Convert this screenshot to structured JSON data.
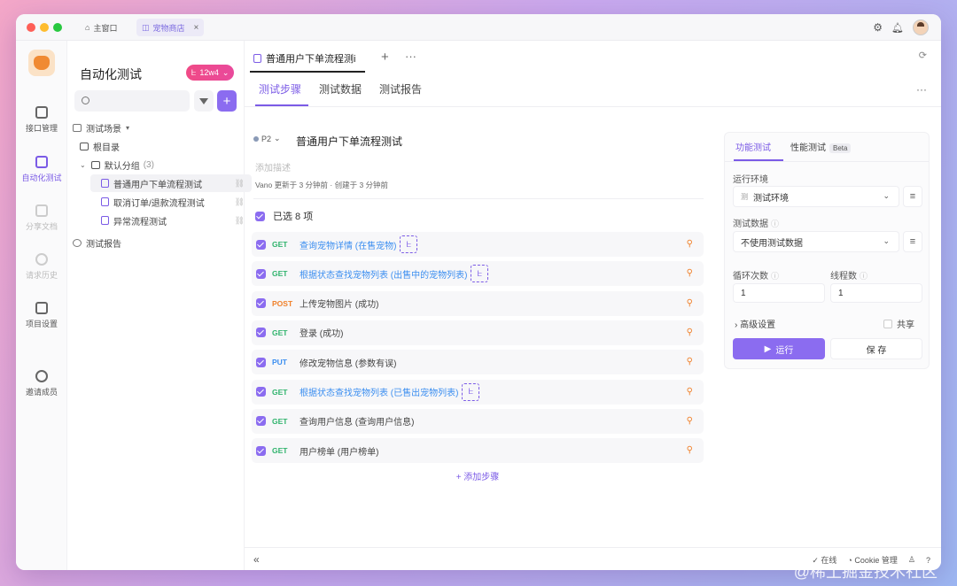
{
  "window_tabs": {
    "home": "主窗口",
    "shop": "宠物商店",
    "close": "×"
  },
  "nav": [
    {
      "label": "接口管理"
    },
    {
      "label": "自动化测试"
    },
    {
      "label": "分享文档"
    },
    {
      "label": "请求历史"
    },
    {
      "label": "项目设置"
    },
    {
      "label": "邀请成员"
    }
  ],
  "tree": {
    "title": "自动化测试",
    "version_badge": "12w4",
    "section": "测试场景",
    "root": "根目录",
    "group": "默认分组",
    "group_count": "(3)",
    "items": [
      "普通用户下单流程测试",
      "取消订单/退款流程测试",
      "异常流程测试"
    ],
    "report": "测试报告"
  },
  "main": {
    "doc_tab": "普通用户下单流程测i",
    "subtabs": [
      "测试步骤",
      "测试数据",
      "测试报告"
    ],
    "priority": "P2",
    "case_title": "普通用户下单流程测试",
    "desc_placeholder": "添加描述",
    "meta": "Vano 更新于 3 分钟前 · 创建于 3 分钟前",
    "selected": "已选 8 项",
    "add_step": "+ 添加步骤"
  },
  "steps": [
    {
      "method": "GET",
      "name": "查询宠物详情 (在售宠物)",
      "link": true
    },
    {
      "method": "GET",
      "name": "根据状态查找宠物列表 (出售中的宠物列表)",
      "link": true
    },
    {
      "method": "POST",
      "name": "上传宠物图片 (成功)",
      "link": false
    },
    {
      "method": "GET",
      "name": "登录 (成功)",
      "link": false
    },
    {
      "method": "PUT",
      "name": "修改宠物信息 (参数有误)",
      "link": false
    },
    {
      "method": "GET",
      "name": "根据状态查找宠物列表 (已售出宠物列表)",
      "link": true
    },
    {
      "method": "GET",
      "name": "查询用户信息 (查询用户信息)",
      "link": false
    },
    {
      "method": "GET",
      "name": "用户榜单 (用户榜单)",
      "link": false
    }
  ],
  "run_panel": {
    "tab_functional": "功能测试",
    "tab_performance": "性能测试",
    "beta": "Beta",
    "env_label": "运行环境",
    "env_value": "测试环境",
    "env_prefix": "测",
    "data_label": "测试数据",
    "data_value": "不使用测试数据",
    "loop_label": "循环次数",
    "loop_value": "1",
    "thread_label": "线程数",
    "thread_value": "1",
    "advanced": "高级设置",
    "share": "共享",
    "run": "运行",
    "save": "保 存"
  },
  "bottom": {
    "online": "在线",
    "cookie": "Cookie 管理"
  },
  "watermark": "@稀土掘金技术社区"
}
